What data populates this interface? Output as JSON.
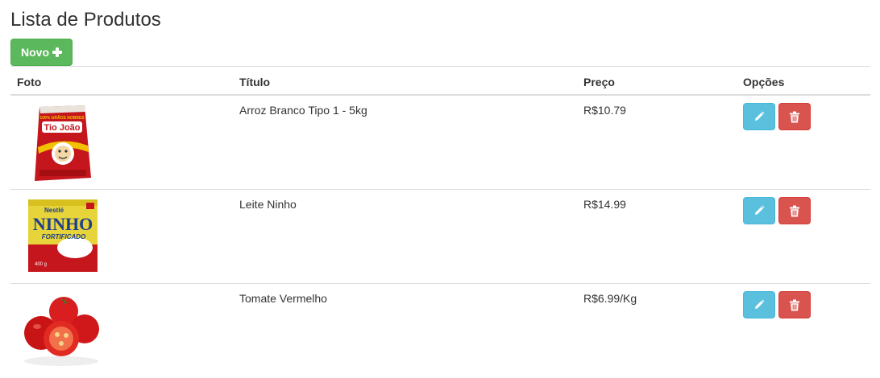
{
  "page": {
    "title": "Lista de Produtos"
  },
  "toolbar": {
    "new_label": "Novo",
    "new_icon": "plus-icon"
  },
  "table": {
    "headers": {
      "foto": "Foto",
      "titulo": "Título",
      "preco": "Preço",
      "opcoes": "Opções"
    },
    "rows": [
      {
        "title": "Arroz Branco Tipo 1 - 5kg",
        "price": "R$10.79",
        "image_brand": "Tio João",
        "image_badge": "100% GRÃOS NOBRES"
      },
      {
        "title": "Leite Ninho",
        "price": "R$14.99",
        "image_brand": "NINHO",
        "image_maker": "Nestlé",
        "image_sub": "FORTIFICADO",
        "image_weight": "400 g"
      },
      {
        "title": "Tomate Vermelho",
        "price": "R$6.99/Kg"
      }
    ],
    "row_actions": {
      "edit_icon": "pencil-icon",
      "delete_icon": "trash-icon"
    }
  },
  "colors": {
    "success": "#5cb85c",
    "info": "#5bc0de",
    "danger": "#d9534f",
    "border": "#dddddd"
  }
}
